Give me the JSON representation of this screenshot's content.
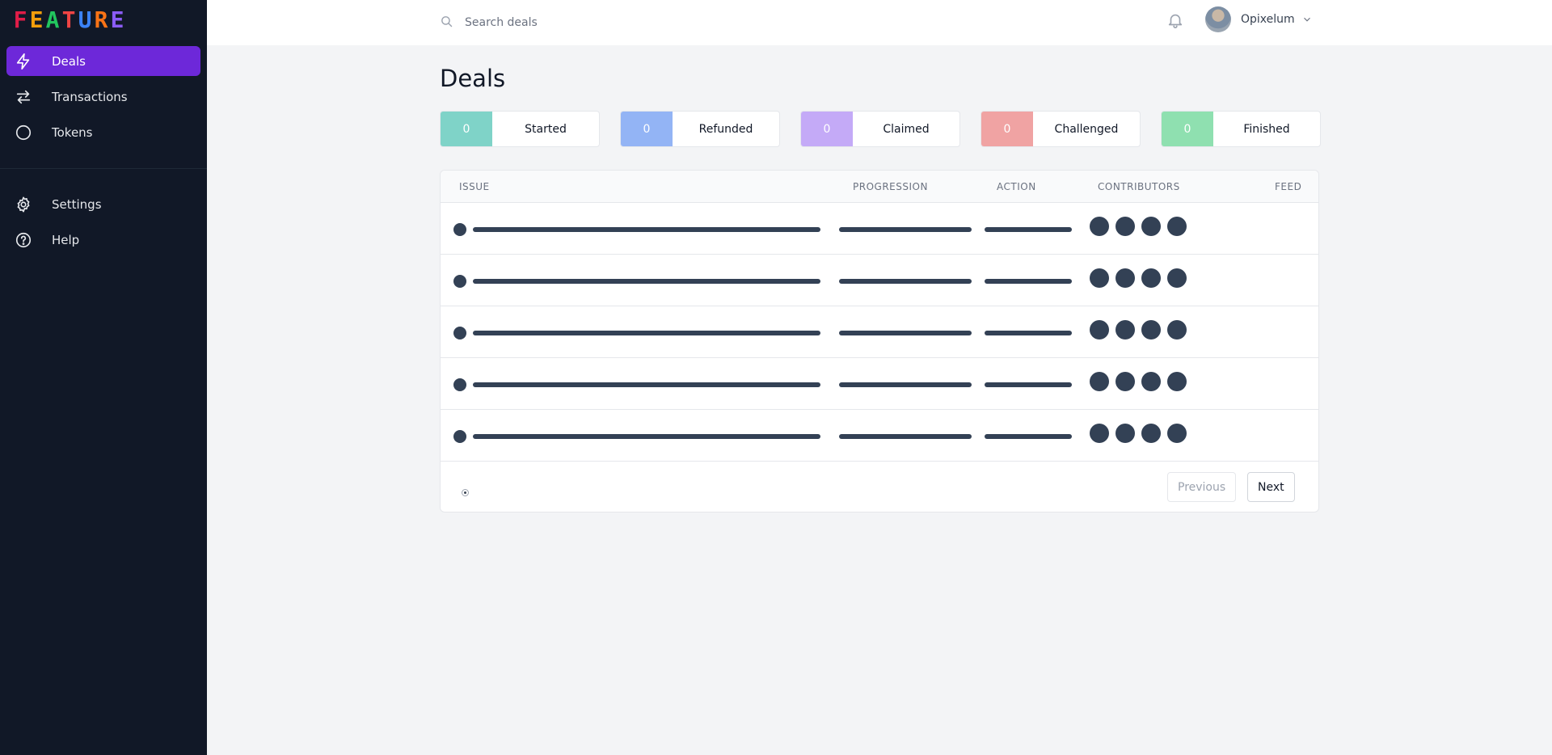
{
  "logo": {
    "letters": [
      "F",
      "E",
      "A",
      "T",
      "U",
      "R",
      "E"
    ],
    "colors": [
      "#e11d48",
      "#f59e0b",
      "#22c55e",
      "#ef4444",
      "#3b82f6",
      "#f97316",
      "#8b5cf6"
    ]
  },
  "sidebar": {
    "items": [
      {
        "label": "Deals",
        "icon": "lightning-icon",
        "active": true
      },
      {
        "label": "Transactions",
        "icon": "arrows-swap-icon",
        "active": false
      },
      {
        "label": "Tokens",
        "icon": "circle-icon",
        "active": false
      }
    ],
    "secondary_items": [
      {
        "label": "Settings",
        "icon": "gear-icon"
      },
      {
        "label": "Help",
        "icon": "question-circle-icon"
      }
    ]
  },
  "topbar": {
    "search_placeholder": "Search deals",
    "user_name": "Opixelum"
  },
  "page": {
    "title": "Deals"
  },
  "stats": [
    {
      "count": "0",
      "label": "Started",
      "color": "#7fd3c8"
    },
    {
      "count": "0",
      "label": "Refunded",
      "color": "#93b4f5"
    },
    {
      "count": "0",
      "label": "Claimed",
      "color": "#c4aaf7"
    },
    {
      "count": "0",
      "label": "Challenged",
      "color": "#f0a3a3"
    },
    {
      "count": "0",
      "label": "Finished",
      "color": "#8fe0b0"
    }
  ],
  "table": {
    "columns": [
      "ISSUE",
      "PROGRESSION",
      "ACTION",
      "CONTRIBUTORS",
      "FEED"
    ],
    "skeleton_rows": 5,
    "skeleton_color": "#334155"
  },
  "pagination": {
    "previous_label": "Previous",
    "next_label": "Next"
  }
}
